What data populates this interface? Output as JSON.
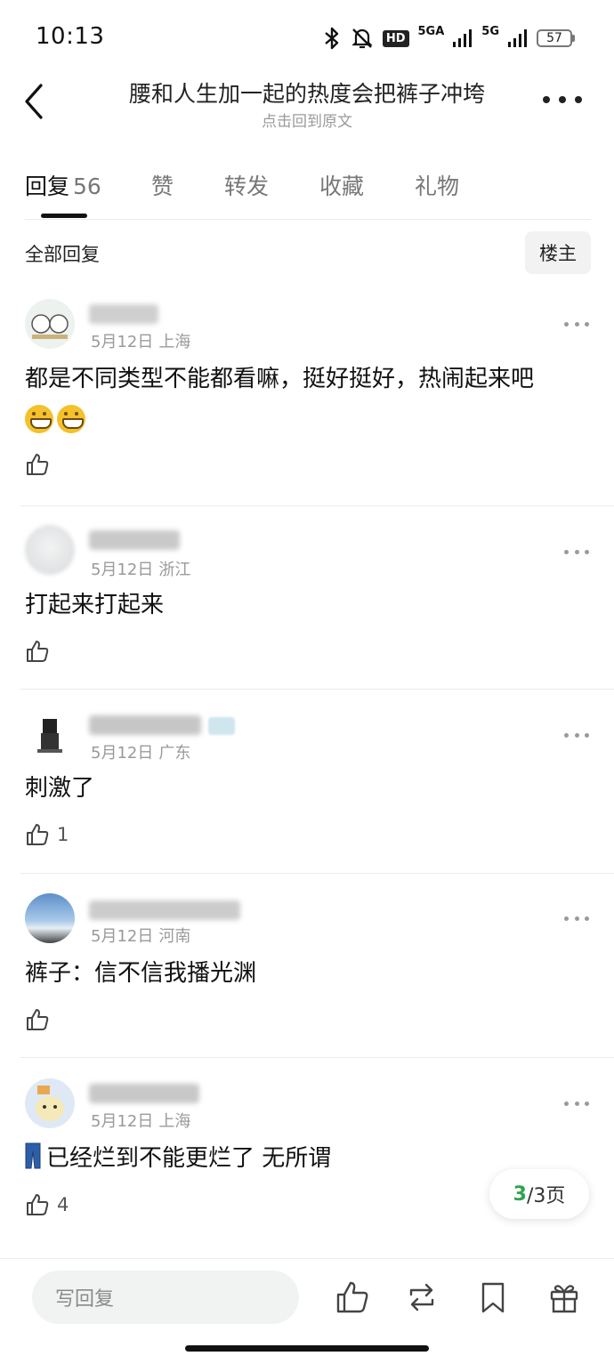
{
  "status_bar": {
    "time": "10:13",
    "hd_label": "HD",
    "net1_label": "5GA",
    "net2_label": "5G",
    "battery": "57"
  },
  "nav": {
    "title": "腰和人生加一起的热度会把裤子冲垮",
    "subtitle": "点击回到原文"
  },
  "tabs": [
    {
      "label": "回复",
      "count": "56",
      "active": true
    },
    {
      "label": "赞"
    },
    {
      "label": "转发"
    },
    {
      "label": "收藏"
    },
    {
      "label": "礼物"
    }
  ],
  "filter": {
    "label": "全部回复",
    "owner_button": "楼主"
  },
  "comments": [
    {
      "date": "5月12日",
      "location": "上海",
      "text": "都是不同类型不能都看嘛，挺好挺好，热闹起来吧",
      "emoji": "grin-emoji",
      "likes": ""
    },
    {
      "date": "5月12日",
      "location": "浙江",
      "text": "打起来打起来",
      "likes": ""
    },
    {
      "date": "5月12日",
      "location": "广东",
      "text": "刺激了",
      "likes": "1"
    },
    {
      "date": "5月12日",
      "location": "河南",
      "text": "裤子：信不信我播光渊",
      "likes": ""
    },
    {
      "date": "5月12日",
      "location": "上海",
      "text": "已经烂到不能更烂了 无所谓",
      "emoji": "jeans-emoji",
      "likes": "4"
    }
  ],
  "pagination": {
    "current": "3",
    "rest": "/3页"
  },
  "bottom_bar": {
    "reply_placeholder": "写回复"
  },
  "colors": {
    "accent_green": "#2ea44f",
    "text_primary": "#111111",
    "text_secondary": "#9a9a9a"
  }
}
